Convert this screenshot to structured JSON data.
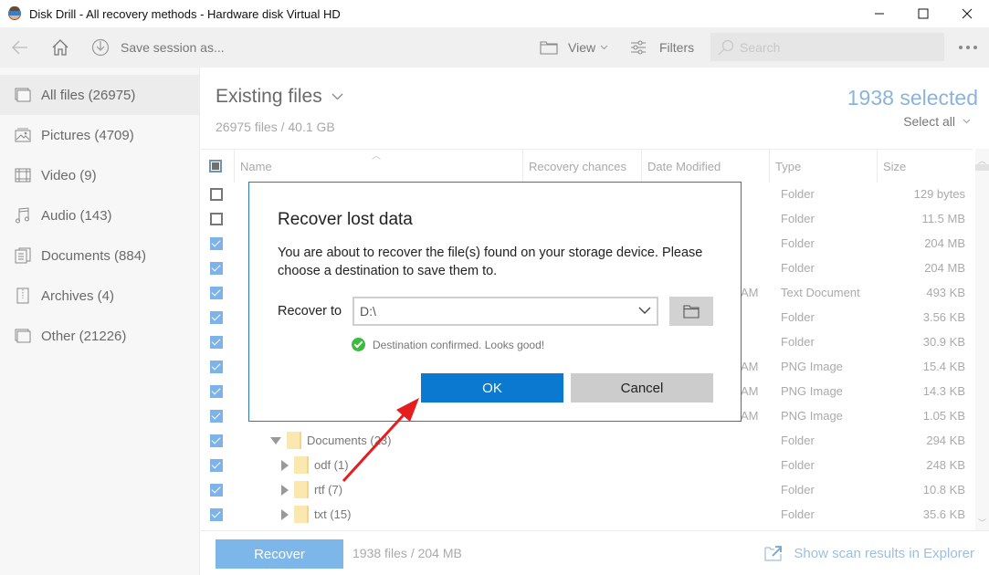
{
  "window": {
    "title": "Disk Drill - All recovery methods - Hardware disk Virtual HD",
    "controls": [
      "minimize",
      "maximize",
      "close"
    ]
  },
  "toolbar": {
    "back_icon": "arrow-left-icon",
    "home_icon": "home-icon",
    "save_session_label": "Save session as...",
    "view_label": "View",
    "filters_label": "Filters",
    "search_placeholder": "Search",
    "search_value": "",
    "more_icon": "ellipsis-icon"
  },
  "sidebar": {
    "items": [
      {
        "label": "All files (26975)",
        "icon": "all-files-icon",
        "active": true
      },
      {
        "label": "Pictures (4709)",
        "icon": "picture-icon",
        "active": false
      },
      {
        "label": "Video (9)",
        "icon": "film-icon",
        "active": false
      },
      {
        "label": "Audio (143)",
        "icon": "music-note-icon",
        "active": false
      },
      {
        "label": "Documents (884)",
        "icon": "document-icon",
        "active": false
      },
      {
        "label": "Archives (4)",
        "icon": "archive-icon",
        "active": false
      },
      {
        "label": "Other (21226)",
        "icon": "other-files-icon",
        "active": false
      }
    ]
  },
  "main": {
    "heading": "Existing files",
    "subheading": "26975 files / 40.1 GB",
    "selected_count": "1938 selected",
    "select_all_label": "Select all",
    "columns": [
      "Name",
      "Recovery chances",
      "Date Modified",
      "Type",
      "Size"
    ],
    "rows": [
      {
        "checked": false,
        "date": "",
        "type": "Folder",
        "size": "129 bytes"
      },
      {
        "checked": false,
        "date": "",
        "type": "Folder",
        "size": "11.5 MB"
      },
      {
        "checked": true,
        "date": "",
        "type": "Folder",
        "size": "204 MB"
      },
      {
        "checked": true,
        "date": "",
        "type": "Folder",
        "size": "204 MB"
      },
      {
        "checked": true,
        "date": "AM",
        "type": "Text Document",
        "size": "493 KB"
      },
      {
        "checked": true,
        "date": "",
        "type": "Folder",
        "size": "3.56 KB"
      },
      {
        "checked": true,
        "date": "",
        "type": "Folder",
        "size": "30.9 KB"
      },
      {
        "checked": true,
        "date": "AM",
        "type": "PNG Image",
        "size": "15.4 KB"
      },
      {
        "checked": true,
        "date": "AM",
        "type": "PNG Image",
        "size": "14.3 KB"
      },
      {
        "checked": true,
        "date": "AM",
        "type": "PNG Image",
        "size": "1.05 KB"
      },
      {
        "checked": true,
        "date": "",
        "type": "Folder",
        "size": "294 KB",
        "name": "Documents (23)",
        "expanded": true,
        "level": 0
      },
      {
        "checked": true,
        "date": "",
        "type": "Folder",
        "size": "248 KB",
        "name": "odf (1)",
        "expanded": false,
        "level": 1
      },
      {
        "checked": true,
        "date": "",
        "type": "Folder",
        "size": "10.8 KB",
        "name": "rtf (7)",
        "expanded": false,
        "level": 1
      },
      {
        "checked": true,
        "date": "",
        "type": "Folder",
        "size": "35.6 KB",
        "name": "txt (15)",
        "expanded": false,
        "level": 1
      }
    ]
  },
  "footer": {
    "recover_label": "Recover",
    "info": "1938 files / 204 MB",
    "explorer_link": "Show scan results in Explorer"
  },
  "dialog": {
    "title": "Recover lost data",
    "message": "You are about to recover the file(s) found on your storage device. Please choose a destination to save them to.",
    "recover_to_label": "Recover to",
    "destination_value": "D:\\",
    "confirmation": "Destination confirmed. Looks good!",
    "ok_label": "OK",
    "cancel_label": "Cancel"
  },
  "colors": {
    "accent": "#0b79d0",
    "selected_count": "#8ab4dc",
    "recover_button": "#7db6e8",
    "checkbox_checked": "#7db3e8",
    "success": "#3cbc3c",
    "annotation_arrow": "#e41e1e"
  }
}
